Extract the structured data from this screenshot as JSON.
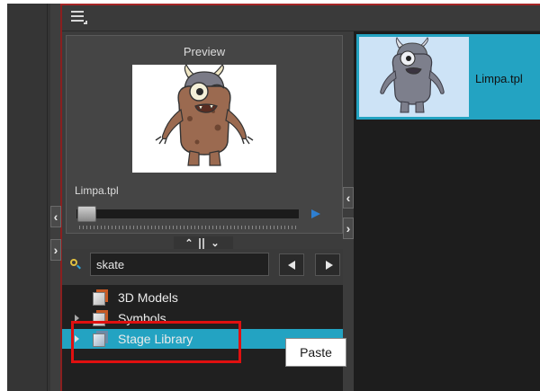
{
  "preview": {
    "title": "Preview",
    "filename": "Limpa.tpl"
  },
  "search": {
    "value": "skate"
  },
  "tree": {
    "items": [
      {
        "label": "3D Models"
      },
      {
        "label": "Symbols"
      },
      {
        "label": "Stage Library"
      }
    ]
  },
  "context": {
    "paste_label": "Paste"
  },
  "thumbnails": {
    "items": [
      {
        "label": "Limpa.tpl"
      }
    ]
  },
  "colors": {
    "selection": "#23a3c2",
    "highlight_box": "#e01010",
    "panel_border_red": "#a62525",
    "play": "#2e7fd1"
  },
  "icons": {
    "menu": "hamburger-menu-icon",
    "search": "search-icon",
    "play": "play-icon",
    "library": "library-folder-icon"
  }
}
